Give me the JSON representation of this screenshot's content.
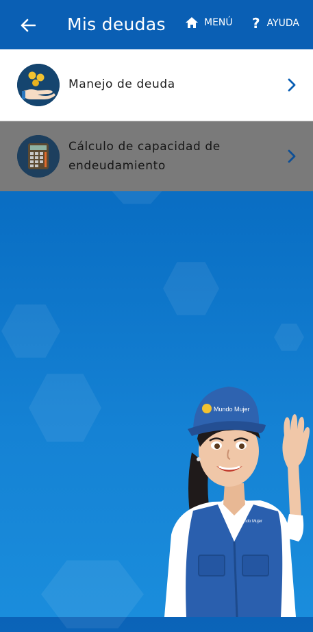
{
  "header": {
    "title": "Mis deudas",
    "menu_label": "MENÚ",
    "help_label": "AYUDA"
  },
  "items": [
    {
      "label": "Manejo de deuda",
      "icon": "hand-coins-icon"
    },
    {
      "label": "Cálculo de capacidad de endeudamiento",
      "icon": "calculator-icon"
    }
  ],
  "mascot": {
    "cap_text": "Mundo Mujer",
    "vest_text": "Mundo Mujer"
  },
  "colors": {
    "header_bg": "#0a5fb4",
    "background": "#0b6ec4",
    "selected_row": "#7a7a7a",
    "chevron": "#0a5fb4"
  }
}
